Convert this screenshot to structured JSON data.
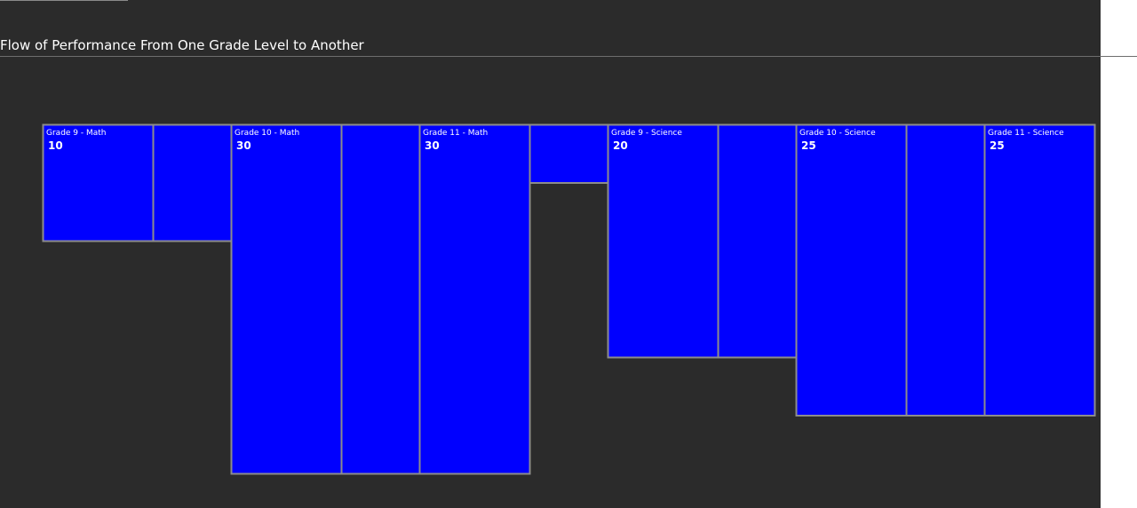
{
  "colors": {
    "background": "#2b2b2b",
    "bar_fill": "#0000ff",
    "bar_border": "#8c8c8c",
    "text": "#ffffff"
  },
  "chart_data": {
    "type": "bar",
    "title": "Flow of Performance From One Grade Level to Another",
    "xlabel": "",
    "ylabel": "",
    "grid": false,
    "legend": "none",
    "ylim": [
      0,
      30
    ],
    "series": [
      {
        "name": "",
        "values": [
          10,
          30,
          30,
          20,
          25,
          25
        ]
      }
    ],
    "categories": [
      "Grade 9 - Math",
      "Grade 10 - Math",
      "Grade 11 - Math",
      "Grade 9 - Science",
      "Grade 10 - Science",
      "Grade 11 - Science"
    ],
    "connectors": [
      {
        "from": "Grade 9 - Math",
        "to": "Grade 10 - Math",
        "range": [
          0,
          10
        ]
      },
      {
        "from": "Grade 10 - Math",
        "to": "Grade 11 - Math",
        "range": [
          0,
          30
        ]
      },
      {
        "from": "Grade 11 - Math",
        "to": "Grade 9 - Science",
        "range": [
          0,
          5
        ]
      },
      {
        "from": "Grade 9 - Science",
        "to": "Grade 10 - Science",
        "range": [
          0,
          20
        ]
      },
      {
        "from": "Grade 10 - Science",
        "to": "Grade 11 - Science",
        "range": [
          0,
          25
        ]
      }
    ]
  }
}
